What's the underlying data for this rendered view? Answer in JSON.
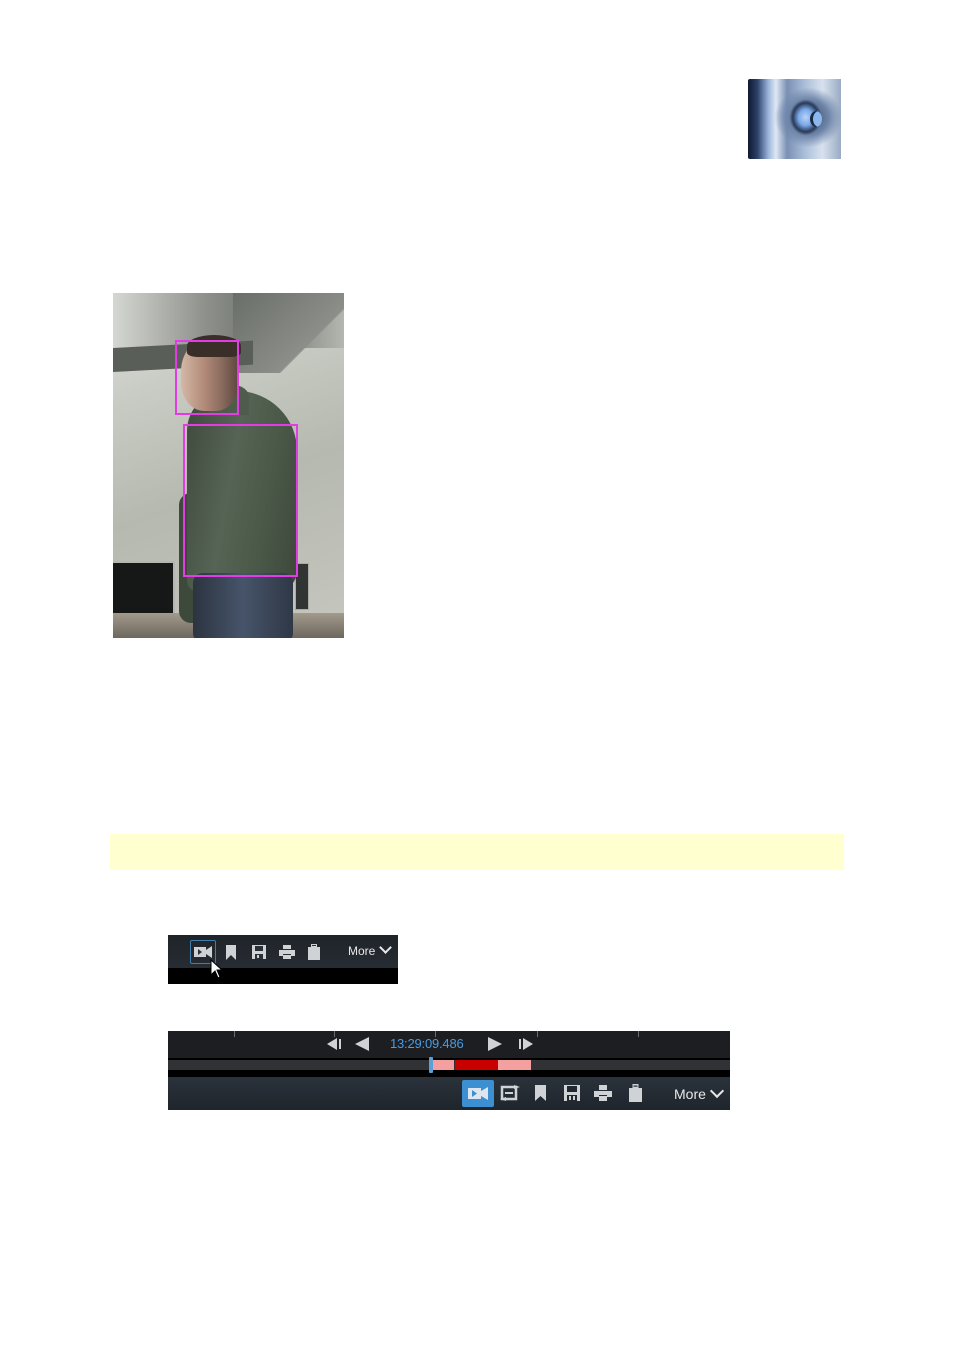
{
  "logo": {
    "alt": "wolf-eye brand logo"
  },
  "photo": {
    "description": "surveillance camera still of a person indoors",
    "detections": [
      {
        "label": "face",
        "color": "#e43ce4"
      },
      {
        "label": "body",
        "color": "#e43ce4"
      }
    ]
  },
  "note_band": {
    "text": "",
    "color": "#ffffd0"
  },
  "toolbar_small": {
    "icons": [
      "camera-icon",
      "bookmark-icon",
      "save-icon",
      "print-icon",
      "clipboard-icon"
    ],
    "selected": "camera-icon",
    "more_label": "More"
  },
  "playback": {
    "time": "13:29:09.486",
    "controls": [
      "step-back-icon",
      "play-reverse-icon",
      "play-forward-icon",
      "step-forward-icon"
    ],
    "timeline": {
      "playhead_fraction": 0.465,
      "segments": [
        {
          "start": 0.47,
          "end": 0.51,
          "color": "#f4a0a0"
        },
        {
          "start": 0.51,
          "end": 0.587,
          "color": "#c80000"
        },
        {
          "start": 0.587,
          "end": 0.645,
          "color": "#f4a0a0"
        }
      ],
      "ticks": [
        0.118,
        0.296,
        0.476,
        0.658,
        0.837
      ]
    },
    "icons": [
      "camera-icon",
      "loop-icon",
      "bookmark-icon",
      "save-icon",
      "print-icon",
      "clipboard-icon"
    ],
    "selected": "camera-icon",
    "more_label": "More",
    "accent": "#3c8fd0"
  }
}
